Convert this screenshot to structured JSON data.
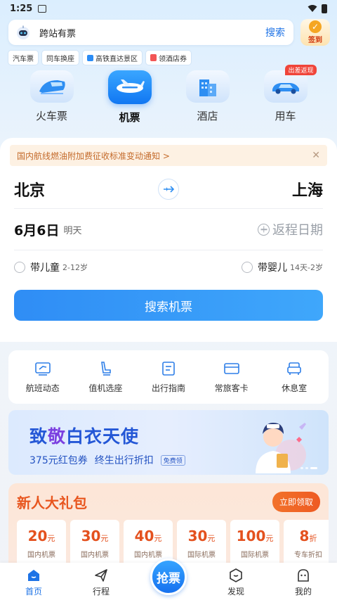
{
  "status_bar": {
    "time": "1:25"
  },
  "search": {
    "placeholder": "跨站有票",
    "button": "搜索"
  },
  "checkin": {
    "label": "签到"
  },
  "chips": [
    "汽车票",
    "同车换座",
    "高铁直达景区",
    "领酒店券"
  ],
  "categories": [
    {
      "label": "火车票",
      "active": false
    },
    {
      "label": "机票",
      "active": true
    },
    {
      "label": "酒店",
      "active": false
    },
    {
      "label": "用车",
      "active": false,
      "badge": "出差返现"
    }
  ],
  "booking": {
    "notice": "国内航线燃油附加费征收标准变动通知 >",
    "from_city": "北京",
    "to_city": "上海",
    "date": "6月6日",
    "date_sub": "明天",
    "return_date": "返程日期",
    "child_option": "带儿童",
    "child_range": "2-12岁",
    "infant_option": "带婴儿",
    "infant_range": "14天-2岁",
    "search_button": "搜索机票"
  },
  "services": [
    {
      "label": "航班动态",
      "icon": "flight-status-icon"
    },
    {
      "label": "值机选座",
      "icon": "seat-icon"
    },
    {
      "label": "出行指南",
      "icon": "guide-icon"
    },
    {
      "label": "常旅客卡",
      "icon": "card-icon"
    },
    {
      "label": "休息室",
      "icon": "lounge-icon"
    }
  ],
  "banner": {
    "title_a": "致",
    "title_b": "敬",
    "title_c": "白衣天使",
    "subtitle_a": "375元红包券",
    "subtitle_b": "终生出行折扣",
    "tag": "免费领"
  },
  "gift": {
    "title": "新人大礼包",
    "button": "立即领取",
    "coupons": [
      {
        "amount": "20",
        "unit": "元",
        "label": "国内机票"
      },
      {
        "amount": "30",
        "unit": "元",
        "label": "国内机票"
      },
      {
        "amount": "40",
        "unit": "元",
        "label": "国内机票"
      },
      {
        "amount": "30",
        "unit": "元",
        "label": "国际机票"
      },
      {
        "amount": "100",
        "unit": "元",
        "label": "国际机票"
      },
      {
        "amount": "8",
        "unit": "折",
        "label": "专车折扣"
      }
    ]
  },
  "tabbar": {
    "home": "首页",
    "trips": "行程",
    "grab": "抢票",
    "discover": "发现",
    "mine": "我的"
  },
  "colors": {
    "accent": "#1e73e6",
    "orange": "#e8561f"
  }
}
